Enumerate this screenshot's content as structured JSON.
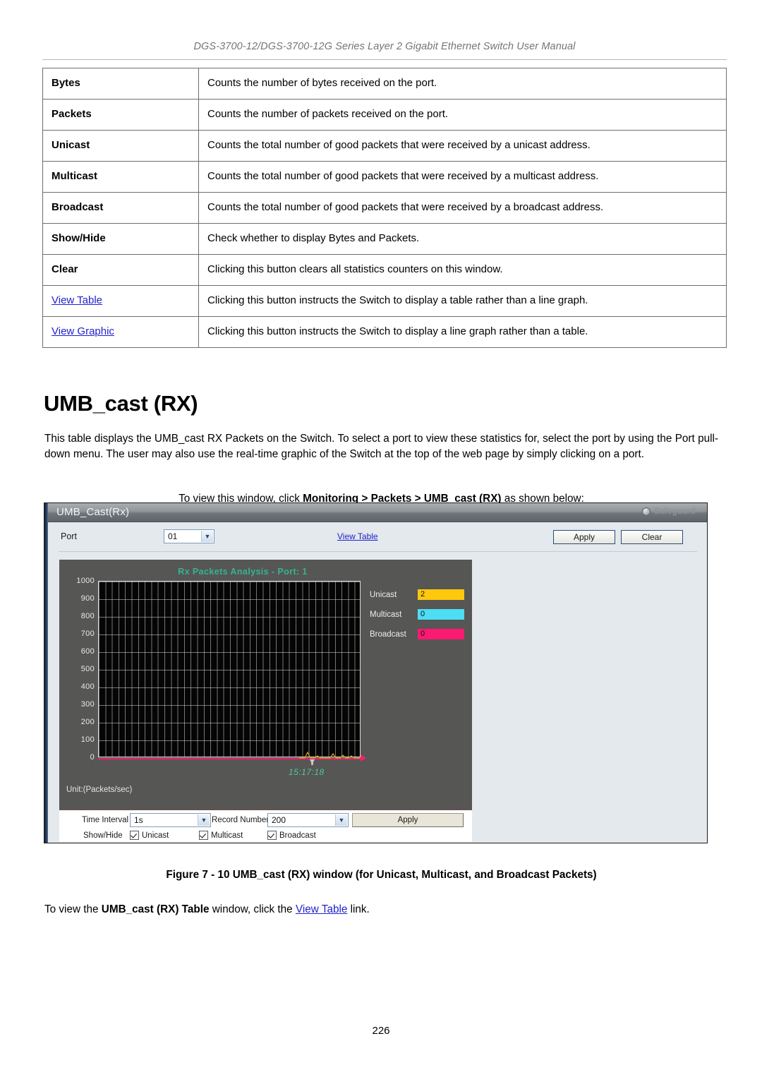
{
  "header": {
    "running_title": "DGS-3700-12/DGS-3700-12G Series Layer 2 Gigabit Ethernet Switch User Manual"
  },
  "desc_table": {
    "rows": [
      {
        "param": "Bytes",
        "is_link": false,
        "description": "Counts the number of bytes received on the port."
      },
      {
        "param": "Packets",
        "is_link": false,
        "description": "Counts the number of packets received on the port."
      },
      {
        "param": "Unicast",
        "is_link": false,
        "description": "Counts the total number of good packets that were received by a unicast address."
      },
      {
        "param": "Multicast",
        "is_link": false,
        "description": "Counts the total number of good packets that were received by a multicast address."
      },
      {
        "param": "Broadcast",
        "is_link": false,
        "description": "Counts the total number of good packets that were received by a broadcast address."
      },
      {
        "param": "Show/Hide",
        "is_link": false,
        "description": "Check whether to display Bytes and Packets."
      },
      {
        "param": "Clear",
        "is_link": false,
        "description": "Clicking this button clears all statistics counters on this window."
      },
      {
        "param": "View Table",
        "is_link": true,
        "description": "Clicking this button instructs the Switch to display a table rather than a line graph."
      },
      {
        "param": "View Graphic",
        "is_link": true,
        "description": "Clicking this button instructs the Switch to display a line graph rather than a table."
      }
    ]
  },
  "section": {
    "title": "UMB_cast (RX)",
    "paragraph": "This table displays the UMB_cast RX Packets on the Switch. To select a port to view these statistics for, select the port by using the Port pull-down menu. The user may also use the real-time graphic of the Switch at the top of the web page by simply clicking on a port.",
    "instruction_prefix": "To view this window, click ",
    "instruction_bold": "Monitoring > Packets > UMB_cast (RX)",
    "instruction_suffix": " as shown below:"
  },
  "figure": {
    "caption": "Figure 7 - 10 UMB_cast (RX) window (for Unicast, Multicast, and Broadcast Packets)"
  },
  "closing": {
    "prefix": "To view the ",
    "bold": "UMB_cast (RX) Table",
    "middle": " window, click the ",
    "link": "View Table",
    "suffix": " link."
  },
  "page_number": "226",
  "screenshot": {
    "window_title": "UMB_Cast(Rx)",
    "safeguard_label": "Safeguard",
    "port_label": "Port",
    "port_value": "01",
    "view_table_link": "View Table",
    "apply_label": "Apply",
    "clear_label": "Clear",
    "graph": {
      "title": "Rx Packets Analysis - Port: 1",
      "unit_label": "Unit:(Packets/sec)",
      "timestamp": "15:17:18"
    },
    "controls": {
      "time_interval_label": "Time Interval",
      "time_interval_value": "1s",
      "record_number_label": "Record Number",
      "record_number_value": "200",
      "apply_label": "Apply",
      "show_hide_label": "Show/Hide",
      "unicast_label": "Unicast",
      "multicast_label": "Multicast",
      "broadcast_label": "Broadcast"
    }
  },
  "chart_data": {
    "type": "line",
    "title": "Rx Packets Analysis - Port: 1",
    "xlabel": "",
    "ylabel": "Unit:(Packets/sec)",
    "ylim": [
      0,
      1000
    ],
    "y_ticks": [
      "1000",
      "900",
      "800",
      "700",
      "600",
      "500",
      "400",
      "300",
      "200",
      "100",
      "0"
    ],
    "x_ticks": [
      "15:17:18"
    ],
    "grid": true,
    "legend_position": "right",
    "series": [
      {
        "name": "Unicast",
        "value": "2",
        "color": "#FFC80D",
        "visible": true
      },
      {
        "name": "Multicast",
        "value": "0",
        "color": "#4DDDF5",
        "visible": true
      },
      {
        "name": "Broadcast",
        "value": "0",
        "color": "#FA1A72",
        "visible": true
      }
    ]
  }
}
